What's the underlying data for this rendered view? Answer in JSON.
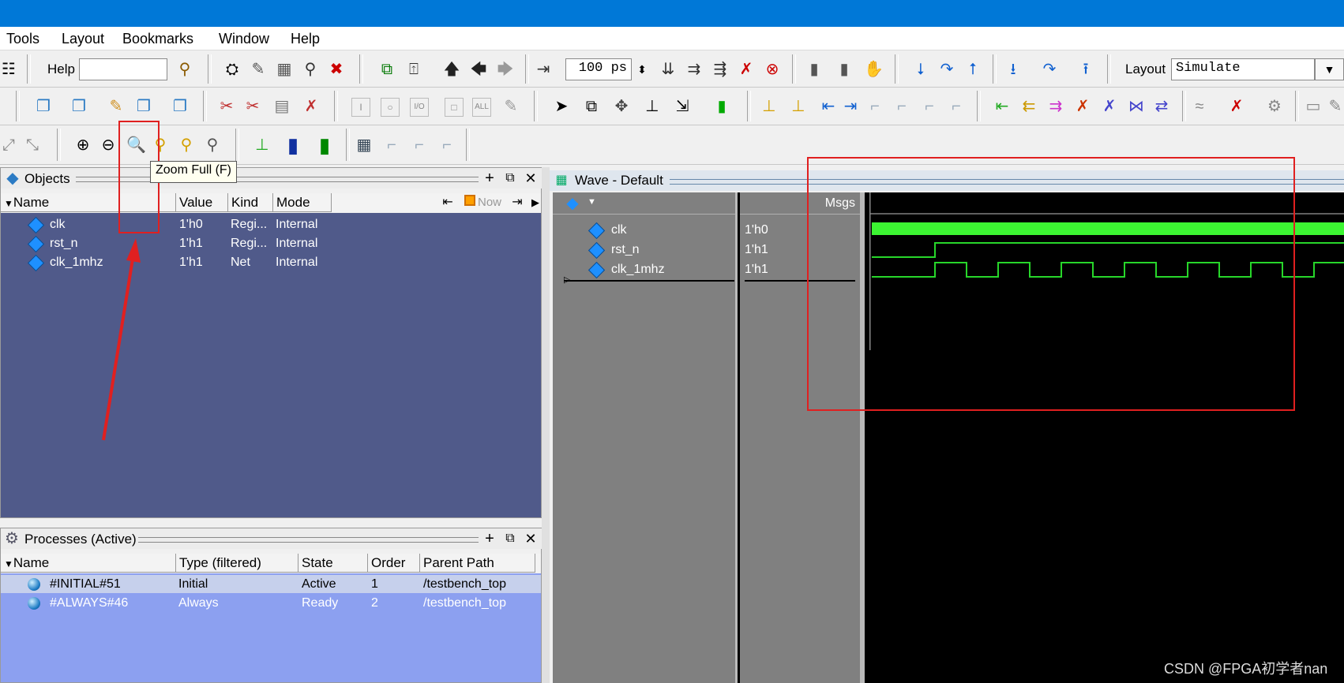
{
  "colors": {
    "titlebar": "#0078d7",
    "objects_bg": "#505a8a",
    "processes_bg": "#8ca0f0",
    "wave_bg": "#000000",
    "wave_green": "#27d62a",
    "wave_green_bright": "#3cf532",
    "annotation_red": "#e02020"
  },
  "menu": [
    "Tools",
    "Layout",
    "Bookmarks",
    "Window",
    "Help"
  ],
  "toolbar": {
    "help_label": "Help",
    "help_value": "",
    "time_value": "100",
    "time_unit": "ps",
    "layout_label": "Layout",
    "layout_value": "Simulate"
  },
  "tooltip": "Zoom Full (F)",
  "objects": {
    "title": "Objects",
    "columns": [
      "Name",
      "Value",
      "Kind",
      "Mode"
    ],
    "now_label": "Now",
    "rows": [
      {
        "name": "clk",
        "value": "1'h0",
        "kind": "Regi...",
        "mode": "Internal"
      },
      {
        "name": "rst_n",
        "value": "1'h1",
        "kind": "Regi...",
        "mode": "Internal"
      },
      {
        "name": "clk_1mhz",
        "value": "1'h1",
        "kind": "Net",
        "mode": "Internal"
      }
    ]
  },
  "processes": {
    "title": "Processes (Active)",
    "columns": [
      "Name",
      "Type (filtered)",
      "State",
      "Order",
      "Parent Path"
    ],
    "rows": [
      {
        "name": "#INITIAL#51",
        "type": "Initial",
        "state": "Active",
        "order": "1",
        "path": "/testbench_top"
      },
      {
        "name": "#ALWAYS#46",
        "type": "Always",
        "state": "Ready",
        "order": "2",
        "path": "/testbench_top"
      }
    ]
  },
  "wave": {
    "title": "Wave - Default",
    "msgs_label": "Msgs",
    "signals": [
      {
        "name": "clk",
        "value": "1'h0"
      },
      {
        "name": "rst_n",
        "value": "1'h1"
      },
      {
        "name": "clk_1mhz",
        "value": "1'h1"
      }
    ]
  },
  "watermark": "CSDN @FPGA初学者nan"
}
